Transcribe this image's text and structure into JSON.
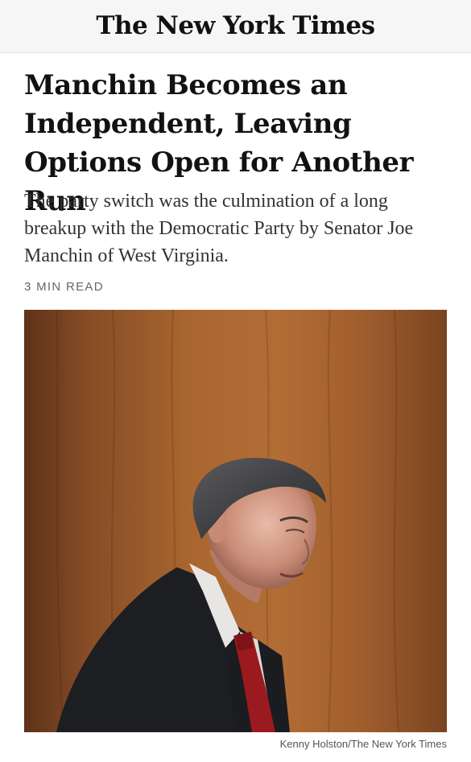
{
  "masthead": {
    "logo_text": "The New York Times"
  },
  "article": {
    "headline": "Manchin Becomes an Independent, Leaving Options Open for Another Run",
    "summary": "The party switch was the culmination of a long breakup with the Democratic Party by Senator Joe Manchin of West Virginia.",
    "read_time": "3 MIN READ",
    "photo_credit": "Kenny Holston/The New York Times"
  },
  "colors": {
    "masthead_bg": "#f6f6f6",
    "headline": "#121212",
    "summary": "#333333",
    "meta": "#666666",
    "wood_panel": "#a5642f"
  }
}
